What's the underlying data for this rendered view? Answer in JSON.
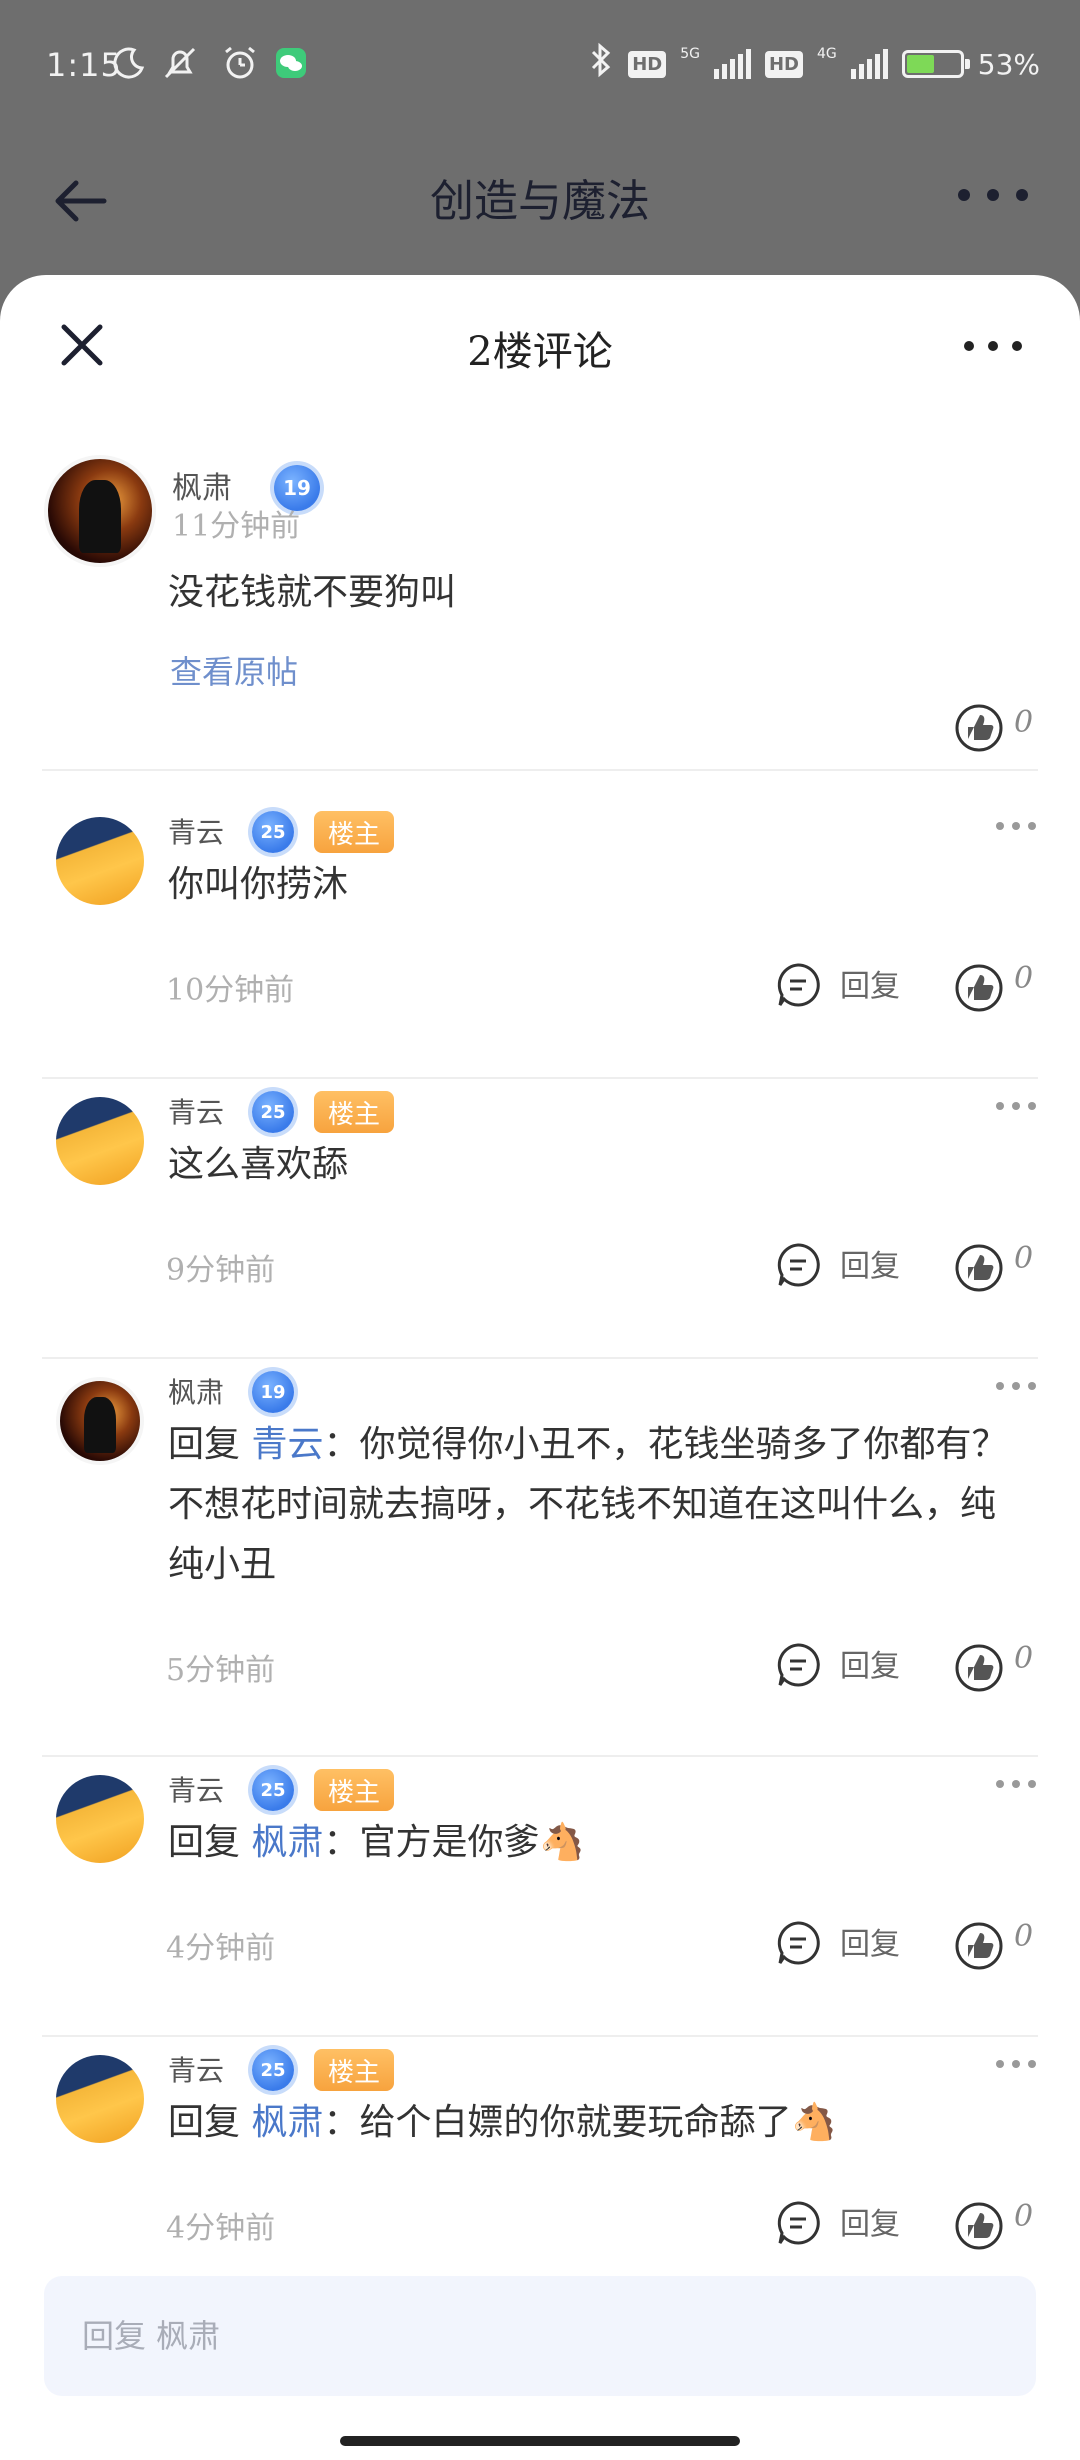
{
  "status_bar": {
    "time": "1:15",
    "net_label_1": "5G",
    "net_label_2": "4G",
    "hd": "HD",
    "battery_percent_text": "53%",
    "battery_level": 0.53,
    "battery_color": "#7ed957"
  },
  "app_header": {
    "title": "创造与魔法"
  },
  "sheet": {
    "title": "2楼评论"
  },
  "main_comment": {
    "author": "枫肃",
    "level": "19",
    "time": "11分钟前",
    "text": "没花钱就不要狗叫",
    "view_original": "查看原帖",
    "likes": "0"
  },
  "replies": [
    {
      "author": "青云",
      "level": "25",
      "tag": "楼主",
      "prefix": "",
      "mention": "",
      "text": "你叫你捞沐",
      "time": "10分钟前",
      "reply_label": "回复",
      "likes": "0"
    },
    {
      "author": "青云",
      "level": "25",
      "tag": "楼主",
      "prefix": "",
      "mention": "",
      "text": "这么喜欢舔",
      "time": "9分钟前",
      "reply_label": "回复",
      "likes": "0"
    },
    {
      "author": "枫肃",
      "level": "19",
      "tag": "",
      "prefix": "回复 ",
      "mention": "青云",
      "text": "：你觉得你小丑不，花钱坐骑多了你都有？不想花时间就去搞呀，不花钱不知道在这叫什么，纯纯小丑",
      "time": "5分钟前",
      "reply_label": "回复",
      "likes": "0"
    },
    {
      "author": "青云",
      "level": "25",
      "tag": "楼主",
      "prefix": "回复 ",
      "mention": "枫肃",
      "text": "：官方是你爹🐴",
      "time": "4分钟前",
      "reply_label": "回复",
      "likes": "0"
    },
    {
      "author": "青云",
      "level": "25",
      "tag": "楼主",
      "prefix": "回复 ",
      "mention": "枫肃",
      "text": "：给个白嫖的你就要玩命舔了🐴",
      "time": "4分钟前",
      "reply_label": "回复",
      "likes": "0"
    }
  ],
  "reply_input": {
    "placeholder": "回复 枫肃"
  },
  "colors": {
    "mention": "#4a78c9",
    "owner_tag": "#f7a33e",
    "level_badge": "#3a7bea",
    "input_bg": "#f2f5fd"
  }
}
